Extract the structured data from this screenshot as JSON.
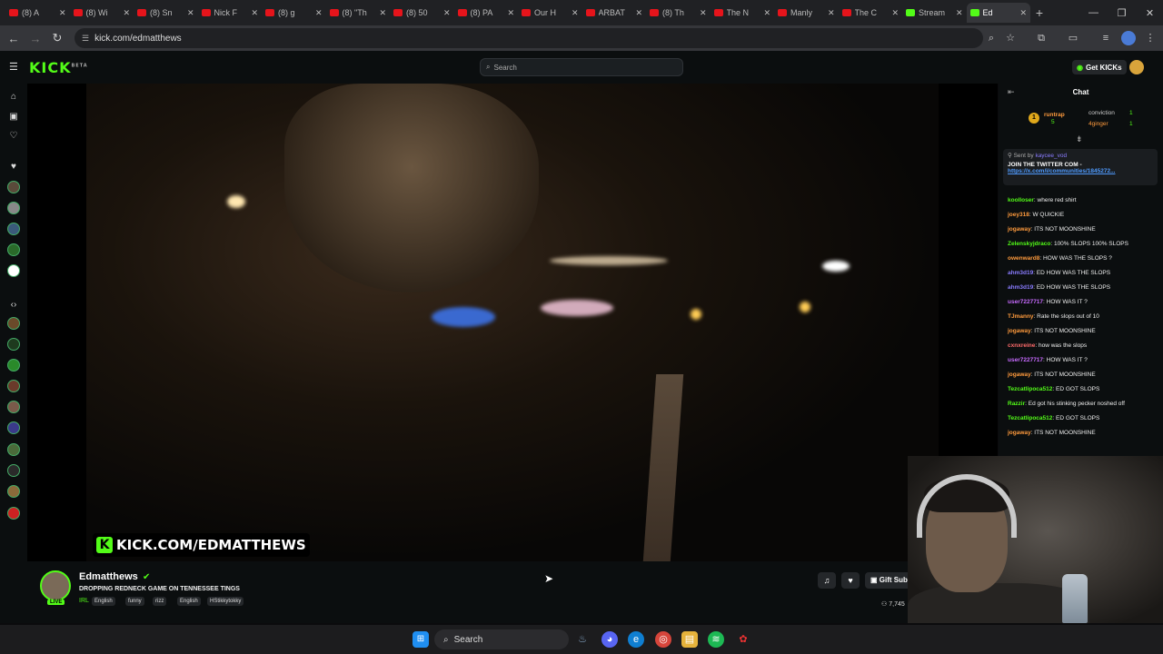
{
  "browser": {
    "tabs": [
      {
        "label": "(8) A",
        "type": "yt"
      },
      {
        "label": "(8) Wi",
        "type": "yt"
      },
      {
        "label": "(8) Sn",
        "type": "yt"
      },
      {
        "label": "Nick F",
        "type": "yt"
      },
      {
        "label": "(8) g",
        "type": "yt"
      },
      {
        "label": "(8) \"Th",
        "type": "yt"
      },
      {
        "label": "(8) 50",
        "type": "yt"
      },
      {
        "label": "(8) PA",
        "type": "yt"
      },
      {
        "label": "Our H",
        "type": "yt"
      },
      {
        "label": "ARBAT",
        "type": "yt"
      },
      {
        "label": "(8) Th",
        "type": "yt"
      },
      {
        "label": "The N",
        "type": "yt"
      },
      {
        "label": "Manly",
        "type": "yt"
      },
      {
        "label": "The C",
        "type": "yt"
      },
      {
        "label": "Stream",
        "type": "kick"
      },
      {
        "label": "Ed",
        "type": "kick",
        "active": true
      }
    ],
    "url": "kick.com/edmatthews"
  },
  "kick": {
    "logo": "KICK",
    "logo_badge": "BETA",
    "search_placeholder": "Search",
    "get_kicks": "Get KICKs"
  },
  "video": {
    "watermark": "KICK.COM/EDMATTHEWS"
  },
  "channel": {
    "name": "Edmatthews",
    "live_badge": "LIVE",
    "title": "DROPPING REDNECK GAME ON TENNESSEE TINGS",
    "category": "IRL",
    "tags": [
      "English",
      "funny",
      "rizz",
      "English",
      "HStikkytokky"
    ],
    "gift_sub": "Gift Sub",
    "viewers": "7,745"
  },
  "chat": {
    "title": "Chat",
    "gifters": [
      {
        "name": "runtrap",
        "count": "5"
      },
      {
        "name": "conviction",
        "count": "1"
      },
      {
        "name": "4ginger",
        "count": "1"
      }
    ],
    "pinned": {
      "sent_by_label": "Sent by",
      "sent_by_user": "kaycee_vod",
      "message": "JOIN THE TWITTER COM -",
      "link": "https://x.com/i/communities/1845272..."
    },
    "messages": [
      {
        "user": "koolloser",
        "text": "where red shirt",
        "color": "#53fc18"
      },
      {
        "user": "joey318",
        "text": "W QUICKIE",
        "color": "#ff9b3d"
      },
      {
        "user": "jogaway",
        "text": "ITS NOT MOONSHINE",
        "color": "#ff9b3d"
      },
      {
        "user": "Zelenskyjdraco",
        "text": "100% SLOPS 100% SLOPS",
        "color": "#53fc18"
      },
      {
        "user": "owenward8",
        "text": "HOW WAS THE SLOPS ?",
        "color": "#ff9b3d"
      },
      {
        "user": "ahm3d19",
        "text": "ED HOW WAS THE SLOPS",
        "color": "#8a7cff"
      },
      {
        "user": "ahm3d19",
        "text": "ED HOW WAS THE SLOPS",
        "color": "#8a7cff"
      },
      {
        "user": "user7227717",
        "text": "HOW WAS IT ?",
        "color": "#c86bff"
      },
      {
        "user": "TJmanny",
        "text": "Rate the slops out of 10",
        "color": "#ff9b3d"
      },
      {
        "user": "jogaway",
        "text": "ITS NOT MOONSHINE",
        "color": "#ff9b3d"
      },
      {
        "user": "cxnxreine",
        "text": "how was the slops",
        "color": "#ff6b6b"
      },
      {
        "user": "user7227717",
        "text": "HOW WAS IT ?",
        "color": "#c86bff"
      },
      {
        "user": "jogaway",
        "text": "ITS NOT MOONSHINE",
        "color": "#ff9b3d"
      },
      {
        "user": "Tezcatlipoca512",
        "text": "ED GOT SLOPS",
        "color": "#53fc18"
      },
      {
        "user": "Razzir",
        "text": "Ed got his stinking pecker noshed off",
        "color": "#53fc18"
      },
      {
        "user": "Tezcatlipoca512",
        "text": "ED GOT SLOPS",
        "color": "#53fc18"
      },
      {
        "user": "jogaway",
        "text": "ITS NOT MOONSHINE",
        "color": "#ff9b3d"
      }
    ]
  },
  "taskbar": {
    "search_label": "Search"
  }
}
